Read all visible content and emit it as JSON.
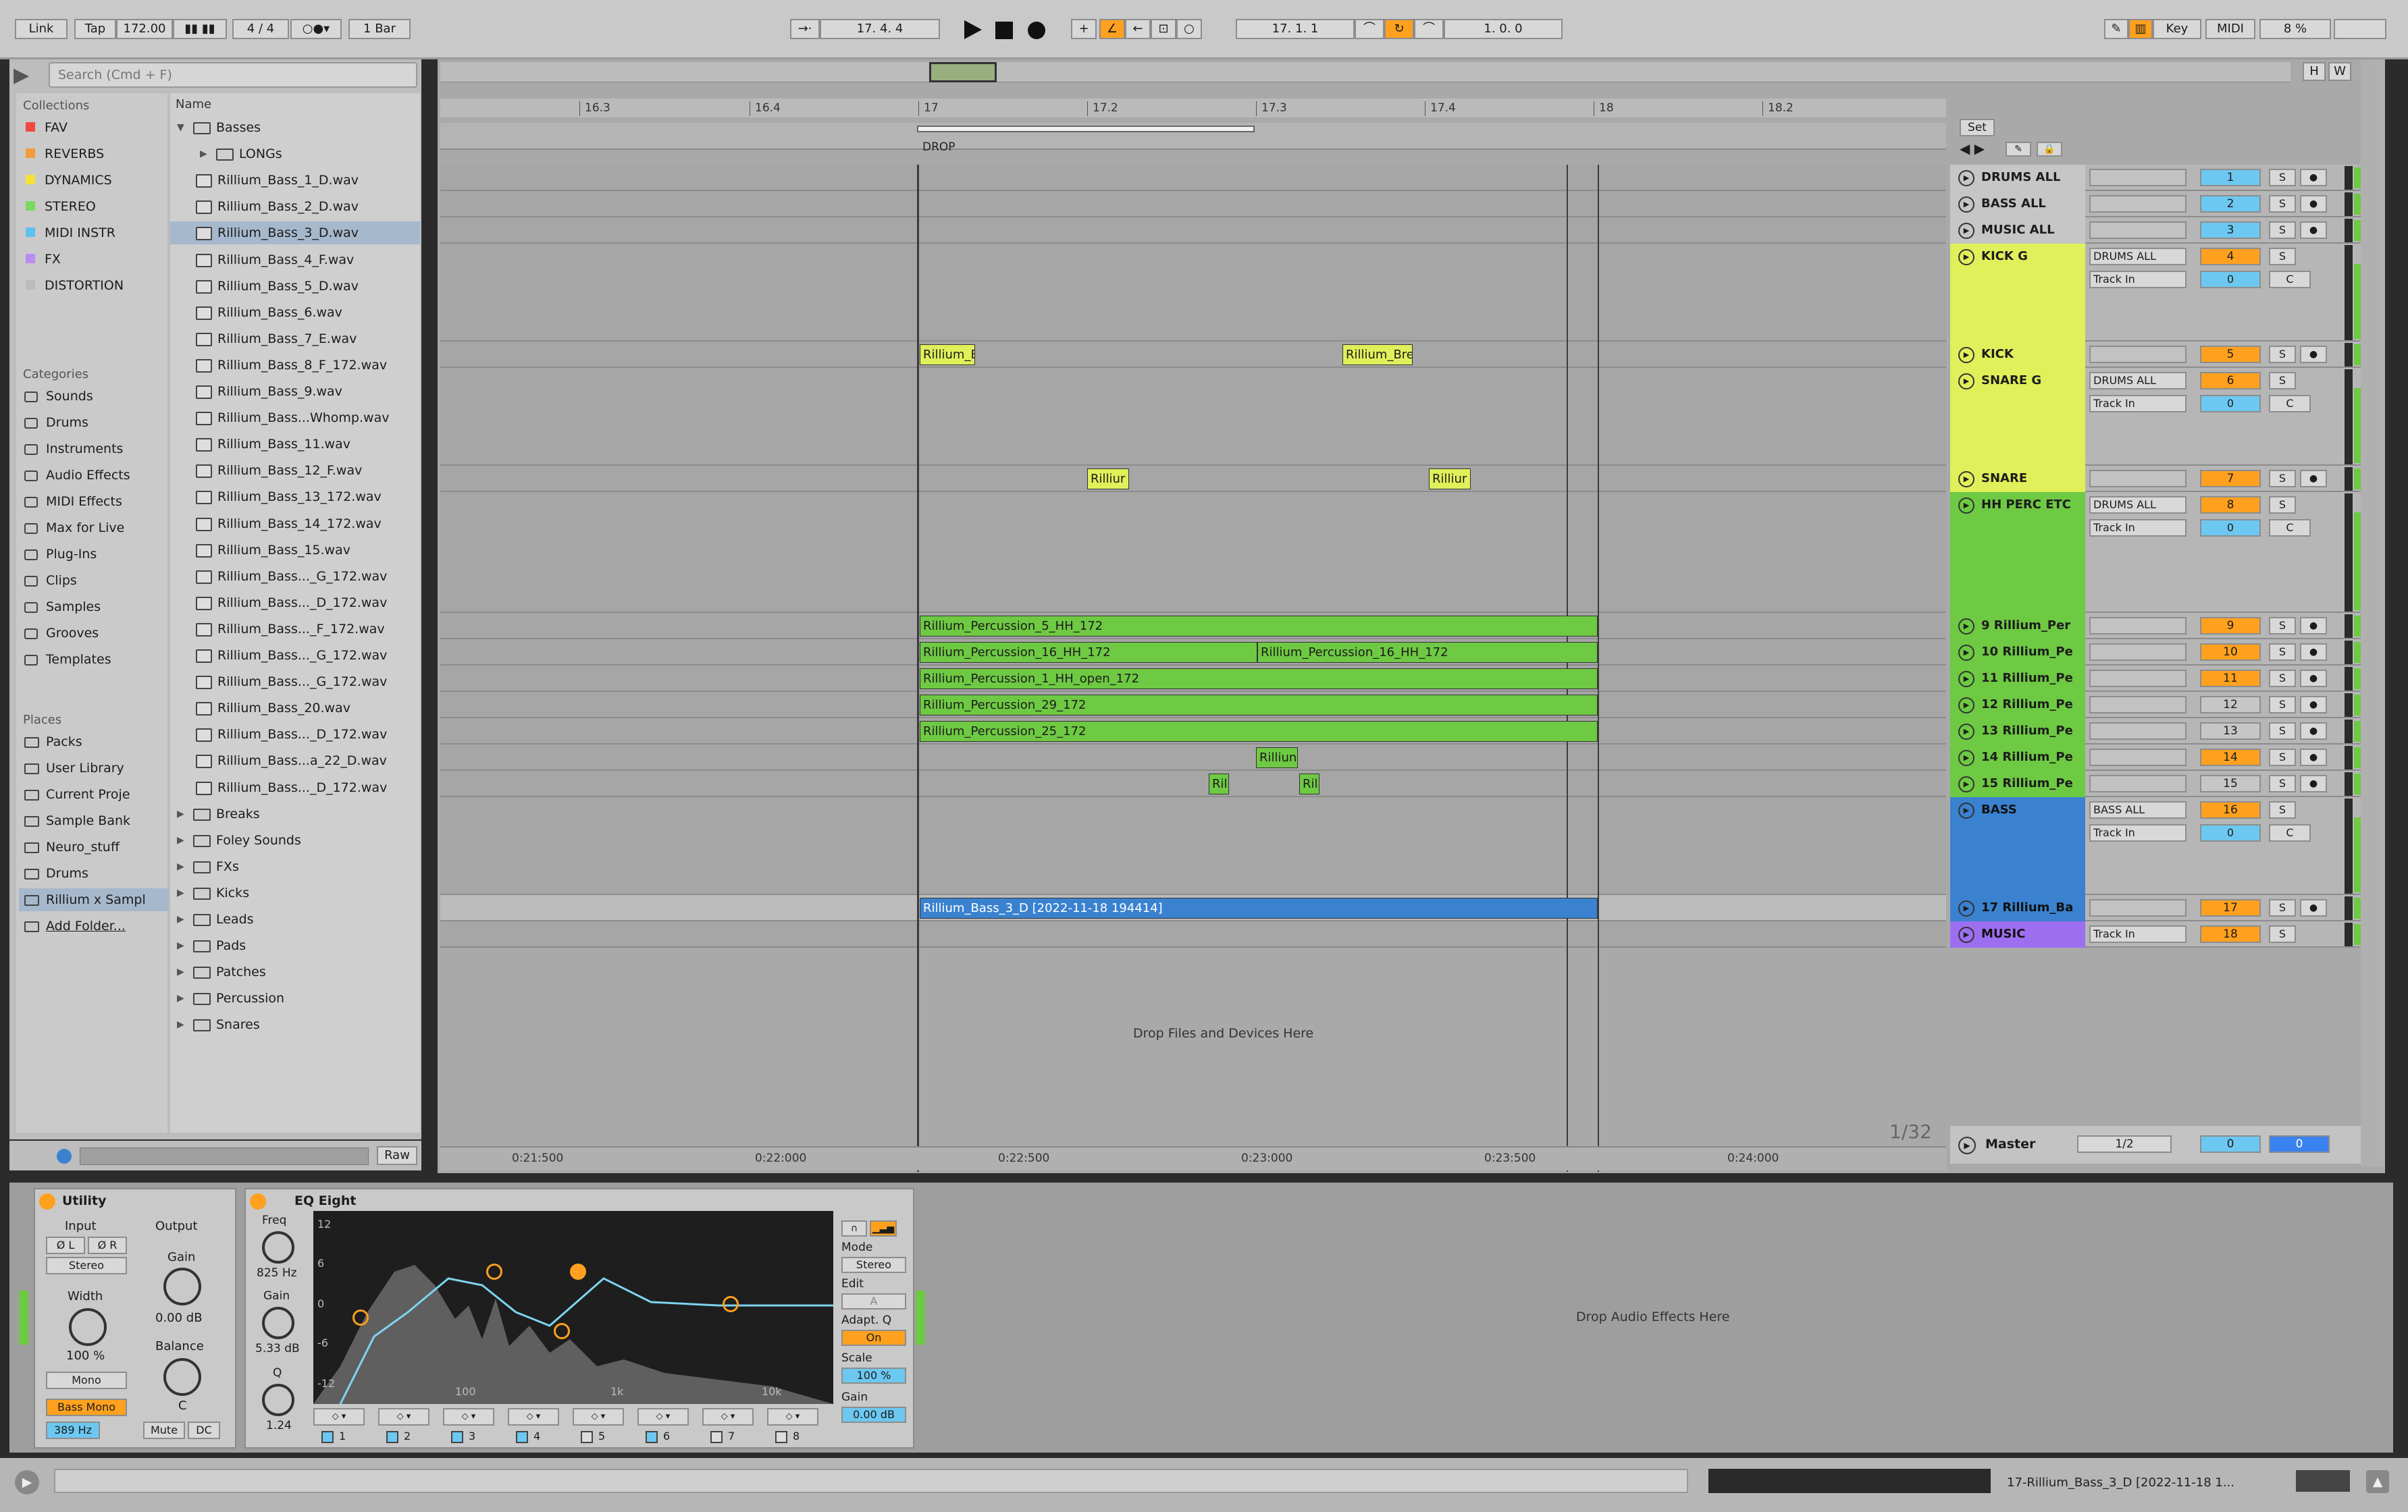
{
  "transport": {
    "link": "Link",
    "tap": "Tap",
    "tempo": "172.00",
    "signature": "4 / 4",
    "quantize": "1 Bar",
    "arrangement_position": "17. 4. 4",
    "loop_start": "17. 1. 1",
    "loop_length": "1. 0. 0",
    "key": "Key",
    "midi": "MIDI",
    "cpu": "8 %"
  },
  "browser": {
    "search_placeholder": "Search (Cmd + F)",
    "collections_title": "Collections",
    "collections": [
      {
        "label": "FAV",
        "color": "#f04a40"
      },
      {
        "label": "REVERBS",
        "color": "#f59a3a"
      },
      {
        "label": "DYNAMICS",
        "color": "#f3e23a"
      },
      {
        "label": "STEREO",
        "color": "#7cd860"
      },
      {
        "label": "MIDI INSTR",
        "color": "#5dc1f0"
      },
      {
        "label": "FX",
        "color": "#b88cf0"
      },
      {
        "label": "DISTORTION",
        "color": "#bcbcbc"
      }
    ],
    "categories_title": "Categories",
    "categories": [
      "Sounds",
      "Drums",
      "Instruments",
      "Audio Effects",
      "MIDI Effects",
      "Max for Live",
      "Plug-Ins",
      "Clips",
      "Samples",
      "Grooves",
      "Templates"
    ],
    "places_title": "Places",
    "places": [
      "Packs",
      "User Library",
      "Current Proje",
      "Sample Bank",
      "Neuro_stuff",
      "Drums",
      "Rillium x Sampl",
      "Add Folder..."
    ],
    "column_header": "Name",
    "files": [
      {
        "label": "Basses",
        "kind": "folder-open",
        "indent": 0
      },
      {
        "label": "LONGs",
        "kind": "folder",
        "indent": 1
      },
      {
        "label": "Rillium_Bass_1_D.wav",
        "kind": "file",
        "indent": 1
      },
      {
        "label": "Rillium_Bass_2_D.wav",
        "kind": "file",
        "indent": 1
      },
      {
        "label": "Rillium_Bass_3_D.wav",
        "kind": "file",
        "indent": 1,
        "selected": true
      },
      {
        "label": "Rillium_Bass_4_F.wav",
        "kind": "file",
        "indent": 1
      },
      {
        "label": "Rillium_Bass_5_D.wav",
        "kind": "file",
        "indent": 1
      },
      {
        "label": "Rillium_Bass_6.wav",
        "kind": "file",
        "indent": 1
      },
      {
        "label": "Rillium_Bass_7_E.wav",
        "kind": "file",
        "indent": 1
      },
      {
        "label": "Rillium_Bass_8_F_172.wav",
        "kind": "file",
        "indent": 1
      },
      {
        "label": "Rillium_Bass_9.wav",
        "kind": "file",
        "indent": 1
      },
      {
        "label": "Rillium_Bass...Whomp.wav",
        "kind": "file",
        "indent": 1
      },
      {
        "label": "Rillium_Bass_11.wav",
        "kind": "file",
        "indent": 1
      },
      {
        "label": "Rillium_Bass_12_F.wav",
        "kind": "file",
        "indent": 1
      },
      {
        "label": "Rillium_Bass_13_172.wav",
        "kind": "file",
        "indent": 1
      },
      {
        "label": "Rillium_Bass_14_172.wav",
        "kind": "file",
        "indent": 1
      },
      {
        "label": "Rillium_Bass_15.wav",
        "kind": "file",
        "indent": 1
      },
      {
        "label": "Rillium_Bass..._G_172.wav",
        "kind": "file",
        "indent": 1
      },
      {
        "label": "Rillium_Bass..._D_172.wav",
        "kind": "file",
        "indent": 1
      },
      {
        "label": "Rillium_Bass..._F_172.wav",
        "kind": "file",
        "indent": 1
      },
      {
        "label": "Rillium_Bass..._G_172.wav",
        "kind": "file",
        "indent": 1
      },
      {
        "label": "Rillium_Bass..._G_172.wav",
        "kind": "file",
        "indent": 1
      },
      {
        "label": "Rillium_Bass_20.wav",
        "kind": "file",
        "indent": 1
      },
      {
        "label": "Rillium_Bass..._D_172.wav",
        "kind": "file",
        "indent": 1
      },
      {
        "label": "Rillium_Bass...a_22_D.wav",
        "kind": "file",
        "indent": 1
      },
      {
        "label": "Rillium_Bass..._D_172.wav",
        "kind": "file",
        "indent": 1
      },
      {
        "label": "Breaks",
        "kind": "folder",
        "indent": 0
      },
      {
        "label": "Foley Sounds",
        "kind": "folder",
        "indent": 0
      },
      {
        "label": "FXs",
        "kind": "folder",
        "indent": 0
      },
      {
        "label": "Kicks",
        "kind": "folder",
        "indent": 0
      },
      {
        "label": "Leads",
        "kind": "folder",
        "indent": 0
      },
      {
        "label": "Pads",
        "kind": "folder",
        "indent": 0
      },
      {
        "label": "Patches",
        "kind": "folder",
        "indent": 0
      },
      {
        "label": "Percussion",
        "kind": "folder",
        "indent": 0
      },
      {
        "label": "Snares",
        "kind": "folder",
        "indent": 0
      }
    ],
    "raw": "Raw"
  },
  "arrangement": {
    "bars": [
      "16.3",
      "16.4",
      "17",
      "17.2",
      "17.3",
      "17.4",
      "18",
      "18.2"
    ],
    "locator": "DROP",
    "set_button": "Set",
    "times": [
      "0:21:500",
      "0:22:000",
      "0:22:500",
      "0:23:000",
      "0:23:500",
      "0:24:000"
    ],
    "zoom": "1/32",
    "drop_hint": "Drop Files and Devices Here",
    "clips": [
      {
        "label": "Rillium_Br",
        "track": 4
      },
      {
        "label": "Rillium_Bre",
        "track": 4
      },
      {
        "label": "Rilliur",
        "track": 6
      },
      {
        "label": "Rilliur",
        "track": 6
      },
      {
        "label": "Rillium_Percussion_5_HH_172",
        "track": 8
      },
      {
        "label": "Rillium_Percussion_16_HH_172",
        "track": 9
      },
      {
        "label": "Rillium_Percussion_16_HH_172",
        "track": 9
      },
      {
        "label": "Rillium_Percussion_1_HH_open_172",
        "track": 10
      },
      {
        "label": "Rillium_Percussion_29_172",
        "track": 11
      },
      {
        "label": "Rillium_Percussion_25_172",
        "track": 12
      },
      {
        "label": "Rilliun",
        "track": 13
      },
      {
        "label": "Ril",
        "track": 14
      },
      {
        "label": "Ril",
        "track": 14
      },
      {
        "label": "Rillium_Bass_3_D [2022-11-18 194414]",
        "track": 16
      }
    ]
  },
  "tracks": [
    {
      "name": "DRUMS ALL",
      "num": "1",
      "color": "#c6c6c6",
      "num_bg": "#6cc8f0",
      "routing": "",
      "monitor": ""
    },
    {
      "name": "BASS ALL",
      "num": "2",
      "color": "#c6c6c6",
      "num_bg": "#6cc8f0",
      "routing": "",
      "monitor": ""
    },
    {
      "name": "MUSIC ALL",
      "num": "3",
      "color": "#c6c6c6",
      "num_bg": "#6cc8f0",
      "routing": "",
      "monitor": ""
    },
    {
      "name": "KICK G",
      "num": "4",
      "color": "#dff05a",
      "num_bg": "#ffa11e",
      "routing": "DRUMS ALL",
      "monitor": "Track In",
      "in_val": "0",
      "c": "C"
    },
    {
      "name": "KICK",
      "num": "5",
      "color": "#dff05a",
      "num_bg": "#ffa11e",
      "routing": "",
      "monitor": ""
    },
    {
      "name": "SNARE G",
      "num": "6",
      "color": "#dff05a",
      "num_bg": "#ffa11e",
      "routing": "DRUMS ALL",
      "monitor": "Track In",
      "in_val": "0",
      "c": "C"
    },
    {
      "name": "SNARE",
      "num": "7",
      "color": "#dff05a",
      "num_bg": "#ffa11e",
      "routing": "",
      "monitor": ""
    },
    {
      "name": "HH PERC ETC",
      "num": "8",
      "color": "#6ec943",
      "num_bg": "#ffa11e",
      "routing": "DRUMS ALL",
      "monitor": "Track In",
      "in_val": "0",
      "c": "C"
    },
    {
      "name": "9 Rillium_Per",
      "num": "9",
      "color": "#6ec943",
      "num_bg": "#ffa11e",
      "routing": "",
      "monitor": ""
    },
    {
      "name": "10 Rillium_Pe",
      "num": "10",
      "color": "#6ec943",
      "num_bg": "#ffa11e",
      "routing": "",
      "monitor": ""
    },
    {
      "name": "11 Rillium_Pe",
      "num": "11",
      "color": "#6ec943",
      "num_bg": "#ffa11e",
      "routing": "",
      "monitor": ""
    },
    {
      "name": "12 Rillium_Pe",
      "num": "12",
      "color": "#6ec943",
      "num_bg": "#c6c6c6",
      "routing": "",
      "monitor": ""
    },
    {
      "name": "13 Rillium_Pe",
      "num": "13",
      "color": "#6ec943",
      "num_bg": "#c6c6c6",
      "routing": "",
      "monitor": ""
    },
    {
      "name": "14 Rillium_Pe",
      "num": "14",
      "color": "#6ec943",
      "num_bg": "#ffa11e",
      "routing": "",
      "monitor": ""
    },
    {
      "name": "15 Rillium_Pe",
      "num": "15",
      "color": "#6ec943",
      "num_bg": "#c6c6c6",
      "routing": "",
      "monitor": ""
    },
    {
      "name": "BASS",
      "num": "16",
      "color": "#3a82d0",
      "num_bg": "#ffa11e",
      "routing": "BASS ALL",
      "monitor": "Track In",
      "in_val": "0",
      "c": "C"
    },
    {
      "name": "17 Rillium_Ba",
      "num": "17",
      "color": "#3a82d0",
      "num_bg": "#ffa11e",
      "routing": "",
      "monitor": ""
    },
    {
      "name": "MUSIC",
      "num": "18",
      "color": "#9d6ff0",
      "num_bg": "#ffa11e",
      "routing": "Track In",
      "monitor": ""
    }
  ],
  "master": {
    "name": "Master",
    "routing": "1/2",
    "vol": "0",
    "pan": "0"
  },
  "mixer_s": "S",
  "utility": {
    "title": "Utility",
    "input": "Input",
    "output": "Output",
    "left": "Ø L",
    "right": "Ø R",
    "mode": "Stereo",
    "width_label": "Width",
    "width_val": "100 %",
    "mono": "Mono",
    "bass_mono": "Bass Mono",
    "bass_freq": "389 Hz",
    "gain_label": "Gain",
    "gain_val": "0.00 dB",
    "balance_label": "Balance",
    "balance_val": "C",
    "mute": "Mute",
    "dc": "DC"
  },
  "eq": {
    "title": "EQ Eight",
    "freq_label": "Freq",
    "freq_val": "825 Hz",
    "gain_label": "Gain",
    "gain_val": "5.33 dB",
    "q_label": "Q",
    "q_val": "1.24",
    "db": [
      "12",
      "6",
      "0",
      "-6",
      "-12"
    ],
    "hz": [
      "100",
      "1k",
      "10k"
    ],
    "mode_label": "Mode",
    "mode_val": "Stereo",
    "edit_label": "Edit",
    "edit_val": "A",
    "adapt_label": "Adapt. Q",
    "adapt_val": "On",
    "scale_label": "Scale",
    "scale_val": "100 %",
    "out_gain_label": "Gain",
    "out_gain_val": "0.00 dB",
    "bands": [
      "1",
      "2",
      "3",
      "4",
      "5",
      "6",
      "7",
      "8"
    ]
  },
  "fx_drop_hint": "Drop Audio Effects Here",
  "status": {
    "clip": "17-Rillium_Bass_3_D [2022-11-18 1..."
  }
}
